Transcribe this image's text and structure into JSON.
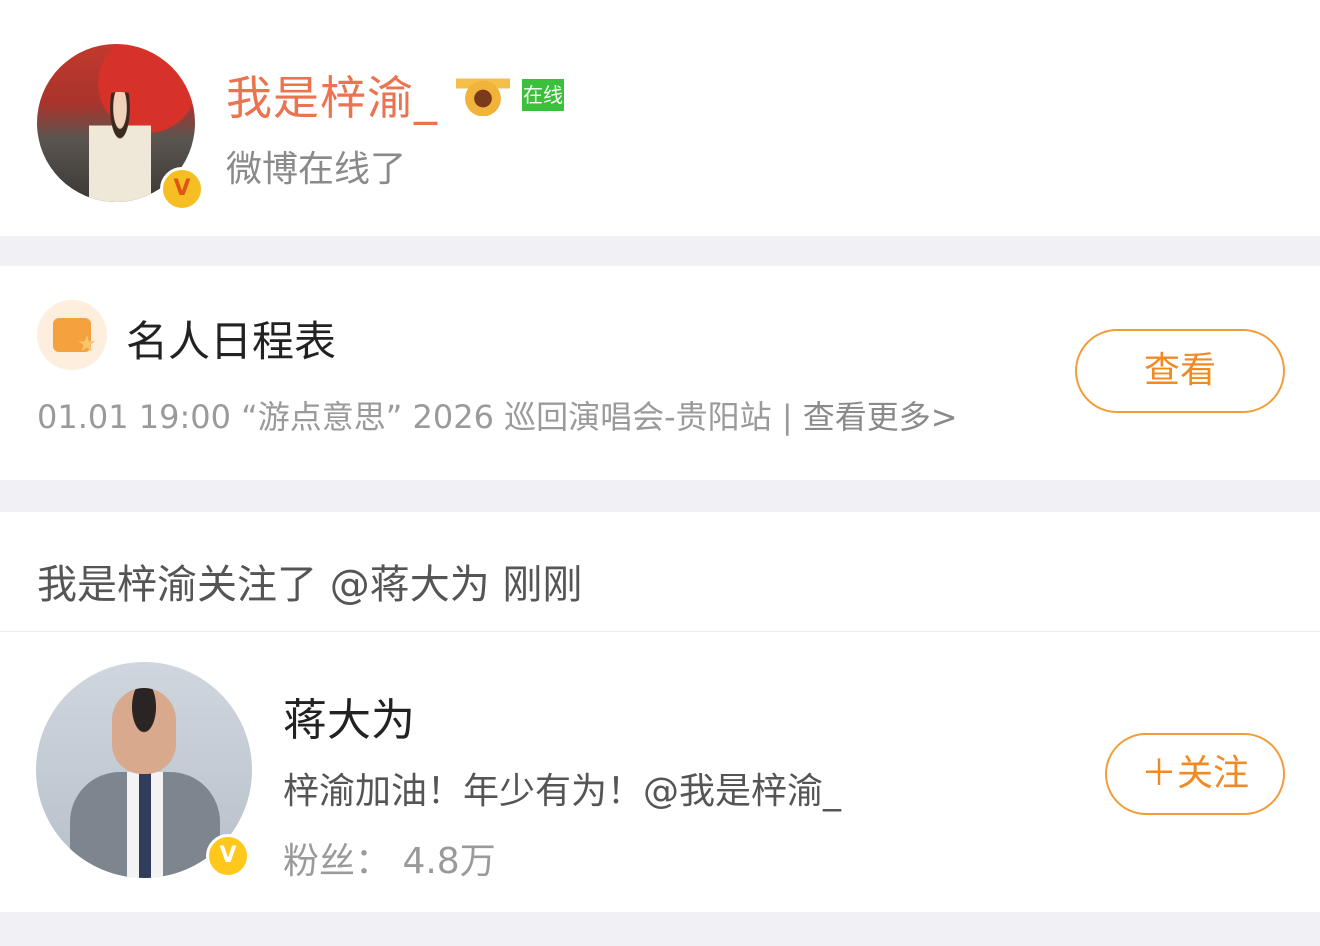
{
  "profile": {
    "name": "我是梓渝_",
    "online_badge": "在线",
    "subtitle": "微博在线了",
    "verified_badge": "V",
    "name_color": "#eb7350"
  },
  "schedule": {
    "title": "名人日程表",
    "event": "01.01 19:00 “游点意思” 2026 巡回演唱会-贵阳站",
    "separator": "|",
    "more_link": "查看更多>",
    "view_button": "查看"
  },
  "activity": {
    "text": "我是梓渝关注了 @蒋大为 刚刚"
  },
  "recommend": {
    "name": "蒋大为",
    "description": "梓渝加油！年少有为！@我是梓渝_",
    "fans": "粉丝：  4.8万",
    "verified_badge": "V",
    "follow_button": "＋关注"
  },
  "colors": {
    "accent": "#f08a24",
    "online": "#3ac03a",
    "background": "#f1f1f5"
  },
  "icons": [
    "verified-icon",
    "crown-icon",
    "calendar-star-icon"
  ]
}
